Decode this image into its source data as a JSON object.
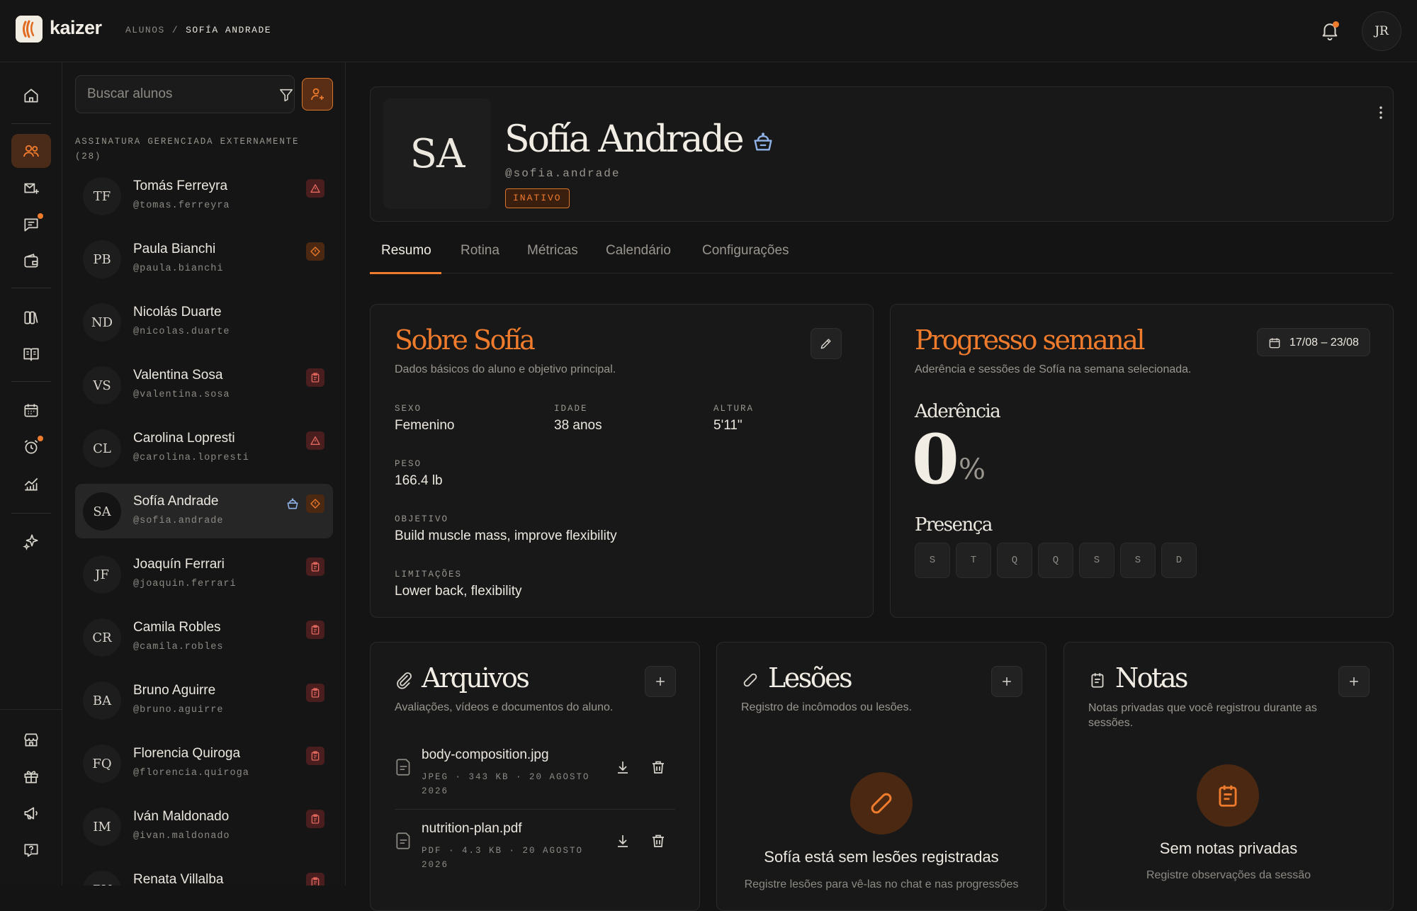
{
  "app": {
    "brand": "kaizer"
  },
  "breadcrumb": {
    "parent": "ALUNOS",
    "separator": "/",
    "current": "SOFÍA ANDRADE"
  },
  "user": {
    "initials": "JR"
  },
  "colors": {
    "accent": "#ef7b2d",
    "background": "#141414",
    "card": "#181818",
    "danger_badge": "#4a1e1e",
    "inactive_badge": "#3a1f0e"
  },
  "rail": {
    "items": [
      {
        "icon": "home-icon"
      },
      {
        "icon": "students-icon",
        "active": true
      },
      {
        "icon": "inbox-icon"
      },
      {
        "icon": "chat-icon",
        "dot": true
      },
      {
        "icon": "wallet-icon"
      },
      {
        "icon": "library-icon"
      },
      {
        "icon": "book-icon"
      },
      {
        "icon": "calendar-icon"
      },
      {
        "icon": "alarm-icon",
        "dot": true
      },
      {
        "icon": "chart-icon"
      },
      {
        "icon": "sparkle-icon"
      },
      {
        "icon": "store-icon"
      },
      {
        "icon": "gift-icon"
      },
      {
        "icon": "megaphone-icon"
      },
      {
        "icon": "help-icon"
      }
    ]
  },
  "search": {
    "placeholder": "Buscar alunos"
  },
  "student_list": {
    "section_title": "ASSINATURA GERENCIADA EXTERNAMENTE (28)",
    "students": [
      {
        "initials": "TF",
        "name": "Tomás Ferreyra",
        "handle": "@tomas.ferreyra",
        "badge": "warning-icon"
      },
      {
        "initials": "PB",
        "name": "Paula Bianchi",
        "handle": "@paula.bianchi",
        "badge": "alert-icon"
      },
      {
        "initials": "ND",
        "name": "Nicolás Duarte",
        "handle": "@nicolas.duarte",
        "badge": ""
      },
      {
        "initials": "VS",
        "name": "Valentina Sosa",
        "handle": "@valentina.sosa",
        "badge": "clipboard-icon"
      },
      {
        "initials": "CL",
        "name": "Carolina Lopresti",
        "handle": "@carolina.lopresti",
        "badge": "warning-icon"
      },
      {
        "initials": "SA",
        "name": "Sofía Andrade",
        "handle": "@sofia.andrade",
        "badge": "alert-icon",
        "crown": true,
        "active": true
      },
      {
        "initials": "JF",
        "name": "Joaquín Ferrari",
        "handle": "@joaquin.ferrari",
        "badge": "clipboard-icon"
      },
      {
        "initials": "CR",
        "name": "Camila Robles",
        "handle": "@camila.robles",
        "badge": "clipboard-icon"
      },
      {
        "initials": "BA",
        "name": "Bruno Aguirre",
        "handle": "@bruno.aguirre",
        "badge": "clipboard-icon"
      },
      {
        "initials": "FQ",
        "name": "Florencia Quiroga",
        "handle": "@florencia.quiroga",
        "badge": "clipboard-icon"
      },
      {
        "initials": "IM",
        "name": "Iván Maldonado",
        "handle": "@ivan.maldonado",
        "badge": "clipboard-icon"
      },
      {
        "initials": "RV",
        "name": "Renata Villalba",
        "handle": "",
        "badge": "clipboard-icon"
      }
    ]
  },
  "profile": {
    "initials": "SA",
    "name": "Sofía Andrade",
    "handle": "@sofia.andrade",
    "status": "INATIVO"
  },
  "tabs": [
    {
      "label": "Resumo",
      "active": true
    },
    {
      "label": "Rotina"
    },
    {
      "label": "Métricas"
    },
    {
      "label": "Calendário"
    },
    {
      "label": "Configurações"
    }
  ],
  "about": {
    "title": "Sobre Sofía",
    "subtitle": "Dados básicos do aluno e objetivo principal.",
    "fields": {
      "sex_label": "SEXO",
      "sex": "Femenino",
      "age_label": "IDADE",
      "age": "38 anos",
      "height_label": "ALTURA",
      "height": "5'11\"",
      "weight_label": "PESO",
      "weight": "166.4 lb",
      "goal_label": "OBJETIVO",
      "goal": "Build muscle mass, improve flexibility",
      "limits_label": "LIMITAÇÕES",
      "limits": "Lower back, flexibility"
    }
  },
  "progress": {
    "title": "Progresso semanal",
    "subtitle": "Aderência e sessões de Sofía na semana selecionada.",
    "date_range": "17/08 – 23/08",
    "adherence_label": "Aderência",
    "adherence_value": "0",
    "adherence_unit": "%",
    "presence_label": "Presença",
    "days": [
      "S",
      "T",
      "Q",
      "Q",
      "S",
      "S",
      "D"
    ]
  },
  "files": {
    "title": "Arquivos",
    "subtitle": "Avaliações, vídeos e documentos do aluno.",
    "items": [
      {
        "name": "body-composition.jpg",
        "meta": "JPEG · 343 KB · 20 AGOSTO 2026"
      },
      {
        "name": "nutrition-plan.pdf",
        "meta": "PDF · 4.3 KB · 20 AGOSTO 2026"
      }
    ]
  },
  "injuries": {
    "title": "Lesões",
    "subtitle": "Registro de incômodos ou lesões.",
    "empty_title": "Sofía está sem lesões registradas",
    "empty_sub": "Registre lesões para vê-las no chat e nas progressões"
  },
  "notes": {
    "title": "Notas",
    "subtitle": "Notas privadas que você registrou durante as sessões.",
    "empty_title": "Sem notas privadas",
    "empty_sub": "Registre observações da sessão"
  }
}
